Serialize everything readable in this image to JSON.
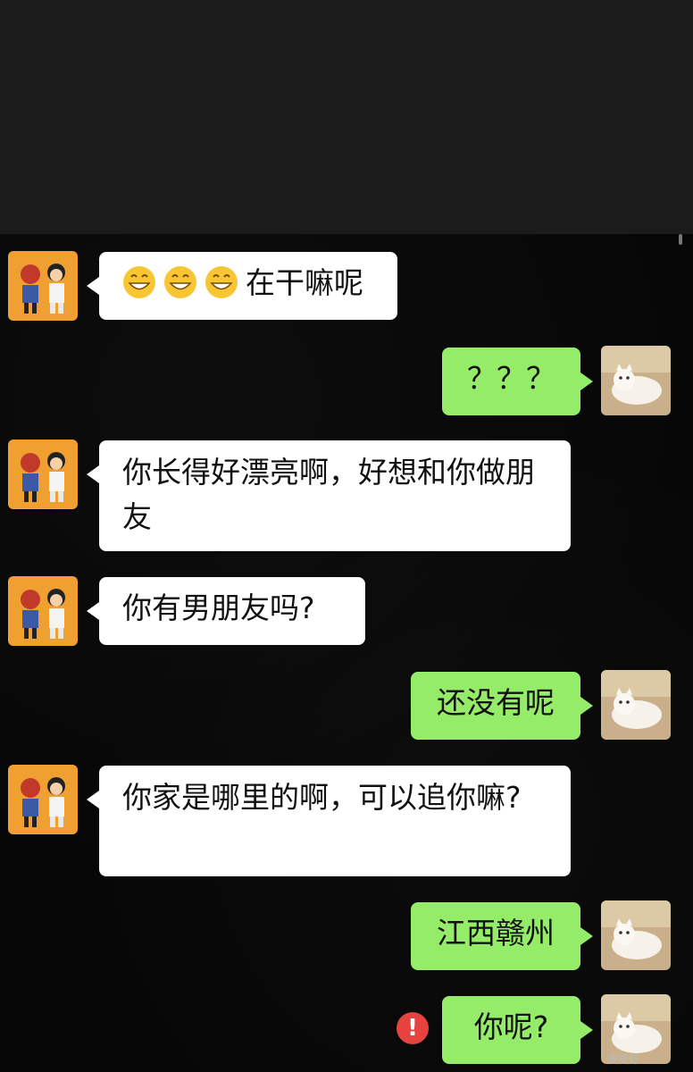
{
  "messages": [
    {
      "side": "left",
      "emoji_prefix": [
        "grin-emoji",
        "grin-emoji",
        "grin-emoji"
      ],
      "text": "在干嘛呢"
    },
    {
      "side": "right",
      "text": "？？？"
    },
    {
      "side": "left",
      "text": "你长得好漂亮啊，好想和你做朋友"
    },
    {
      "side": "left",
      "text": "你有男朋友吗?"
    },
    {
      "side": "right",
      "text": "还没有呢"
    },
    {
      "side": "left",
      "text": "你家是哪里的啊，可以追你嘛?"
    },
    {
      "side": "right",
      "text": "江西赣州"
    },
    {
      "side": "right",
      "text": "你呢?",
      "status": "send-failed"
    }
  ],
  "error_icon": "!",
  "watermark": "皮皮虾",
  "icons": {
    "contact_avatar": "cartoon-boy-girl-avatar",
    "self_avatar": "white-cat-avatar",
    "emoji": "grin-emoji",
    "failed": "exclamation-icon"
  },
  "colors": {
    "incoming_bubble": "#ffffff",
    "outgoing_bubble": "#95ec69",
    "error": "#e64340"
  }
}
